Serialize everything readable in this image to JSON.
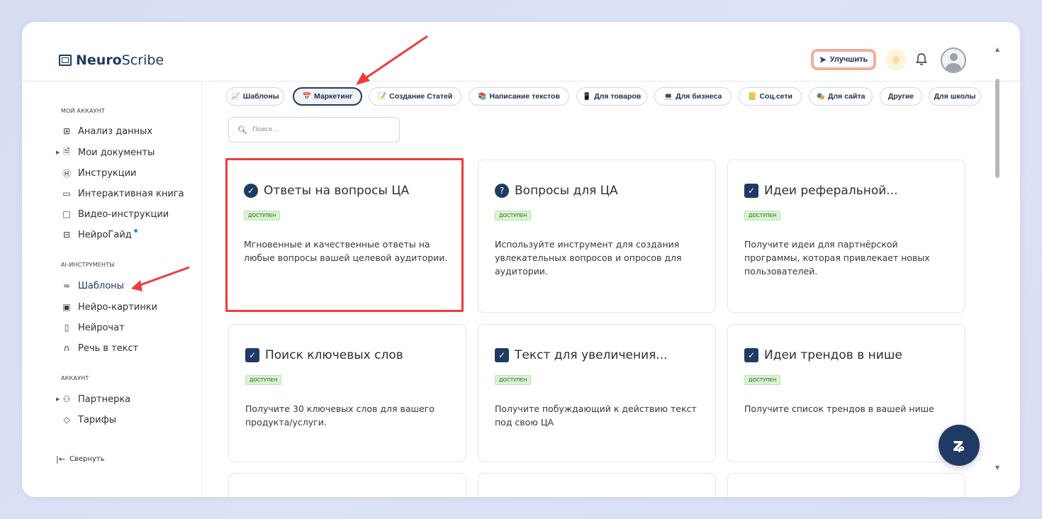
{
  "header": {
    "logo_bold": "Neuro",
    "logo_rest": "Scribe",
    "upgrade_label": "Улучшить"
  },
  "sidebar": {
    "sections": [
      {
        "title": "МОЙ АККАУНТ"
      },
      {
        "title": "AI-ИНСТРУМЕНТЫ"
      },
      {
        "title": "АККАУНТ"
      }
    ],
    "items": [
      {
        "label": "Анализ данных",
        "icon": "grid-icon"
      },
      {
        "label": "Мои документы",
        "icon": "document-icon"
      },
      {
        "label": "Инструкции",
        "icon": "help-circle-icon"
      },
      {
        "label": "Интерактивная книга",
        "icon": "book-icon"
      },
      {
        "label": "Видео-инструкции",
        "icon": "video-icon"
      },
      {
        "label": "НейроГайд",
        "icon": "guide-icon"
      },
      {
        "label": "Шаблоны",
        "icon": "layers-icon"
      },
      {
        "label": "Нейро-картинки",
        "icon": "image-icon"
      },
      {
        "label": "Нейрочат",
        "icon": "chat-icon"
      },
      {
        "label": "Речь в текст",
        "icon": "headphones-icon"
      },
      {
        "label": "Партнерка",
        "icon": "users-icon"
      },
      {
        "label": "Тарифы",
        "icon": "tag-icon"
      }
    ],
    "collapse_label": "Свернуть"
  },
  "tabs": [
    {
      "label": "Шаблоны",
      "icon": "chart-icon"
    },
    {
      "label": "Маркетинг",
      "icon": "calendar-icon",
      "active": true
    },
    {
      "label": "Создание Статей",
      "icon": "memo-icon"
    },
    {
      "label": "Написание текстов",
      "icon": "books-icon"
    },
    {
      "label": "Для товаров",
      "icon": "phone-icon"
    },
    {
      "label": "Для бизнеса",
      "icon": "laptop-icon"
    },
    {
      "label": "Соц.сети",
      "icon": "ledger-icon"
    },
    {
      "label": "Для сайта",
      "icon": "mask-icon"
    },
    {
      "label": "Другие",
      "icon": ""
    },
    {
      "label": "Для школы",
      "icon": ""
    }
  ],
  "search": {
    "placeholder": "Поиск..."
  },
  "cards": [
    {
      "title": "Ответы на вопросы ЦА",
      "badge": "доступен",
      "description": "Мгновенные и качественные ответы на любые вопросы вашей целевой аудитории.",
      "icon": "check-circle-icon"
    },
    {
      "title": "Вопросы для ЦА",
      "badge": "доступен",
      "description": "Используйте инструмент для создания увлекательных вопросов и опросов для аудитории.",
      "icon": "question-circle-icon"
    },
    {
      "title": "Идеи реферальной...",
      "badge": "доступен",
      "description": "Получите идеи для партнёрской программы, которая привлекает новых пользователей.",
      "icon": "check-square-icon"
    },
    {
      "title": "Поиск ключевых слов",
      "badge": "доступен",
      "description": "Получите 30 ключевых слов для вашего продукта/услуги.",
      "icon": "check-square-icon"
    },
    {
      "title": "Текст для увеличения...",
      "badge": "доступен",
      "description": "Получите побуждающий к действию текст под свою ЦА",
      "icon": "check-square-icon"
    },
    {
      "title": "Идеи трендов в нише",
      "badge": "доступен",
      "description": "Получите список трендов в вашей нише",
      "icon": "check-square-icon"
    }
  ],
  "colors": {
    "accent": "#1f3a64",
    "highlight": "#ef3b3b",
    "badge_bg": "#d7f5cf"
  }
}
